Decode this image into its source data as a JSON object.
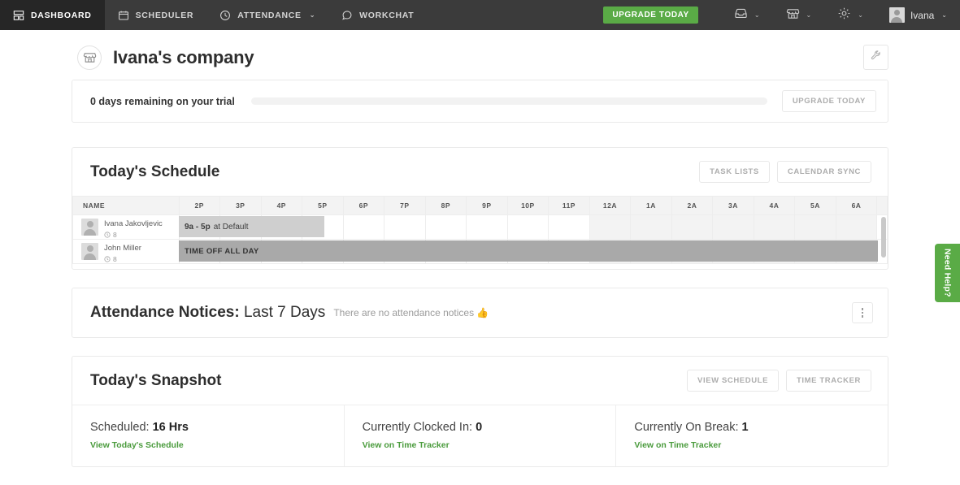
{
  "nav": {
    "items": [
      {
        "label": "DASHBOARD",
        "icon": "dashboard-icon",
        "active": true,
        "caret": false
      },
      {
        "label": "SCHEDULER",
        "icon": "calendar-icon",
        "active": false,
        "caret": false
      },
      {
        "label": "ATTENDANCE",
        "icon": "clock-icon",
        "active": false,
        "caret": true
      },
      {
        "label": "WORKCHAT",
        "icon": "chat-icon",
        "active": false,
        "caret": false
      }
    ],
    "upgrade_label": "UPGRADE TODAY",
    "icons": [
      {
        "name": "inbox-icon",
        "caret": true
      },
      {
        "name": "store-icon",
        "caret": true
      },
      {
        "name": "gear-icon",
        "caret": true
      }
    ],
    "user_name": "Ivana",
    "caret_glyph": "⌄"
  },
  "header": {
    "company_icon": "store-icon",
    "title": "Ivana's company",
    "settings_icon": "wrench-icon"
  },
  "trial": {
    "text": "0 days remaining on your trial",
    "progress_percent": 0,
    "upgrade_label": "UPGRADE TODAY"
  },
  "schedule": {
    "title": "Today's Schedule",
    "actions": [
      "TASK LISTS",
      "CALENDAR SYNC"
    ],
    "name_column": "NAME",
    "time_columns": [
      "2P",
      "3P",
      "4P",
      "5P",
      "6P",
      "7P",
      "8P",
      "9P",
      "10P",
      "11P",
      "12A",
      "1A",
      "2A",
      "3A",
      "4A",
      "5A",
      "6A"
    ],
    "next_day_start_index": 10,
    "rows": [
      {
        "name": "Ivana Jakovljevic",
        "hours": "8",
        "hours_icon": "clock-icon",
        "bar_kind": "shift",
        "bar_bold": "9a - 5p",
        "bar_text": "at Default",
        "bar_start_col": 0,
        "bar_span_cols": 3.5
      },
      {
        "name": "John Miller",
        "hours": "8",
        "hours_icon": "clock-icon",
        "bar_kind": "timeoff",
        "bar_bold": "",
        "bar_text": "TIME OFF ALL DAY",
        "bar_start_col": 0,
        "bar_span_cols": 17
      }
    ]
  },
  "attendance": {
    "title_bold": "Attendance Notices:",
    "title_light": "Last 7 Days",
    "empty_text": "There are no attendance notices 👍",
    "menu_icon": "kebab-menu-icon"
  },
  "snapshot": {
    "title": "Today's Snapshot",
    "actions": [
      "VIEW SCHEDULE",
      "TIME TRACKER"
    ],
    "columns": [
      {
        "label": "Scheduled:",
        "value": "16 Hrs",
        "link": "View Today's Schedule"
      },
      {
        "label": "Currently Clocked In:",
        "value": "0",
        "link": "View on Time Tracker"
      },
      {
        "label": "Currently On Break:",
        "value": "1",
        "link": "View on Time Tracker"
      }
    ]
  },
  "help_tab": {
    "label": "Need Help?"
  },
  "colors": {
    "nav_bg": "#3b3b3b",
    "nav_active_bg": "#262626",
    "brand_green": "#5aab46",
    "link_green": "#4a9b3c",
    "shift_bar": "#cfcfcf",
    "timeoff_bar": "#a9a9a9"
  }
}
